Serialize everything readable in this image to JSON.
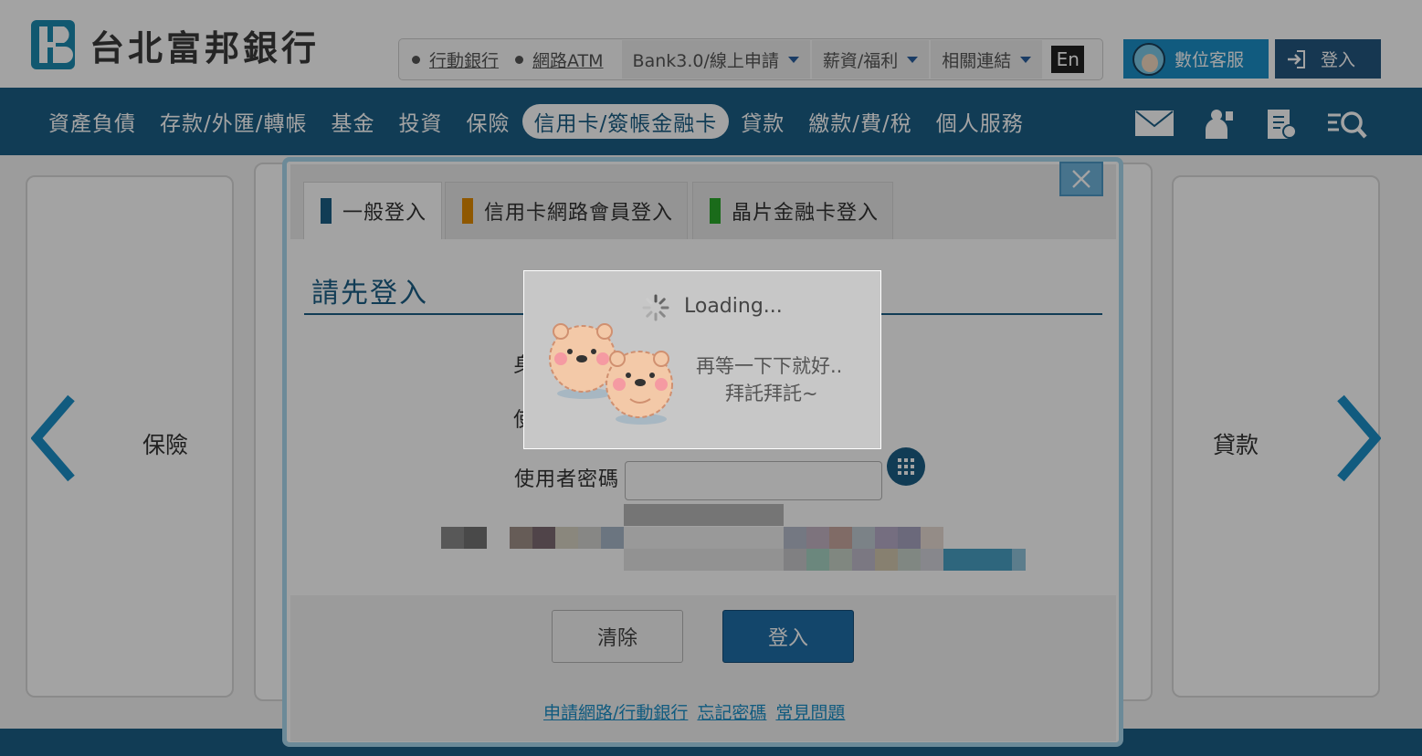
{
  "header": {
    "bank_name": "台北富邦銀行",
    "utility_links": [
      "行動銀行",
      "網路ATM"
    ],
    "utility_dropdowns": [
      "Bank3.0/線上申請",
      "薪資/福利",
      "相關連結"
    ],
    "lang_toggle": "En",
    "customer_service": "數位客服",
    "login": "登入"
  },
  "nav": {
    "items": [
      "資產負債",
      "存款/外匯/轉帳",
      "基金",
      "投資",
      "保險",
      "信用卡/簽帳金融卡",
      "貸款",
      "繳款/費/稅",
      "個人服務"
    ],
    "active_index": 5,
    "icons": [
      "mail-icon",
      "advisor-icon",
      "bill-icon",
      "search-icon"
    ]
  },
  "carousel": {
    "left_label": "保險",
    "right_label": "貸款"
  },
  "modal": {
    "tabs": [
      {
        "label": "一般登入",
        "color": "#1b5e86"
      },
      {
        "label": "信用卡網路會員登入",
        "color": "#e08a00"
      },
      {
        "label": "晶片金融卡登入",
        "color": "#2aa82a"
      }
    ],
    "heading": "請先登入",
    "fields": {
      "id_label_partial": "身",
      "user_label_partial": "使",
      "password_label": "使用者密碼",
      "password_value": ""
    },
    "buttons": {
      "clear": "清除",
      "submit": "登入"
    },
    "links": [
      "申請網路/行動銀行",
      "忘記密碼",
      "常見問題"
    ]
  },
  "loading": {
    "title": "Loading...",
    "line1": "再等一下下就好..",
    "line2": "拜託拜託~"
  },
  "colors": {
    "brand": "#1b5e86",
    "accent": "#1c8fc7"
  }
}
